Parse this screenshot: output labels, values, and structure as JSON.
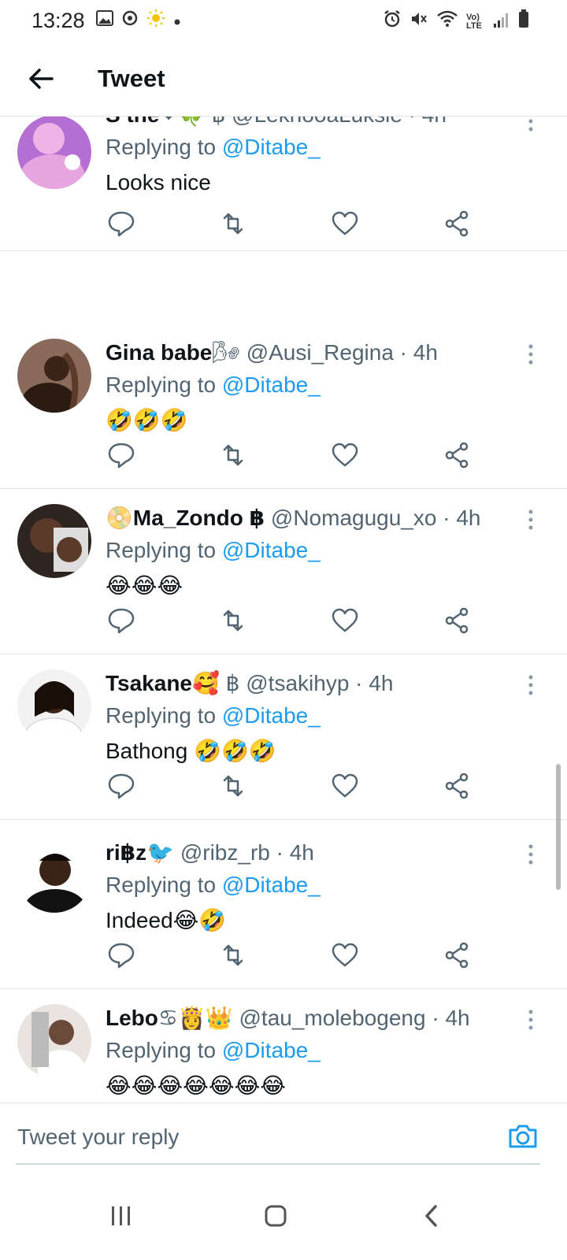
{
  "status_bar": {
    "time": "13:28",
    "volte": "Vo) LTE"
  },
  "header": {
    "title": "Tweet"
  },
  "reply_prefix": "Replying to",
  "tweets": [
    {
      "name": "S the",
      "emoji": "❤🍀",
      "extra": " ฿ ",
      "handle": "@LekhooaLuksie",
      "time": "4h",
      "reply_to": "@Ditabe_",
      "text": "Looks nice"
    },
    {
      "name": "Gina babe",
      "emoji": "🌬",
      "extra": " ",
      "handle": "@Ausi_Regina",
      "time": "4h",
      "reply_to": "@Ditabe_",
      "text": "🤣🤣🤣"
    },
    {
      "name": "📀Ma_Zondo ฿",
      "emoji": "",
      "extra": " ",
      "handle": "@Nomagugu_xo",
      "time": "4h",
      "reply_to": "@Ditabe_",
      "text": "😂😂😂"
    },
    {
      "name": "Tsakane",
      "emoji": "🥰",
      "extra": " ฿ ",
      "handle": "@tsakihyp",
      "time": "4h",
      "reply_to": "@Ditabe_",
      "text": "Bathong 🤣🤣🤣"
    },
    {
      "name": "ri฿z",
      "emoji": "🐦",
      "extra": " ",
      "handle": "@ribz_rb",
      "time": "4h",
      "reply_to": "@Ditabe_",
      "text": "Indeed😂🤣"
    },
    {
      "name": "Lebo",
      "emoji": "♋👸👑",
      "extra": " ",
      "handle": "@tau_molebogeng",
      "time": "4h",
      "reply_to": "@Ditabe_",
      "text": "😂😂😂😂😂😂😂"
    }
  ],
  "reply_bar": {
    "placeholder": "Tweet your reply"
  },
  "colors": {
    "accent": "#1d9bf0",
    "secondary_text": "#536471",
    "divider": "#e1e4e6"
  }
}
